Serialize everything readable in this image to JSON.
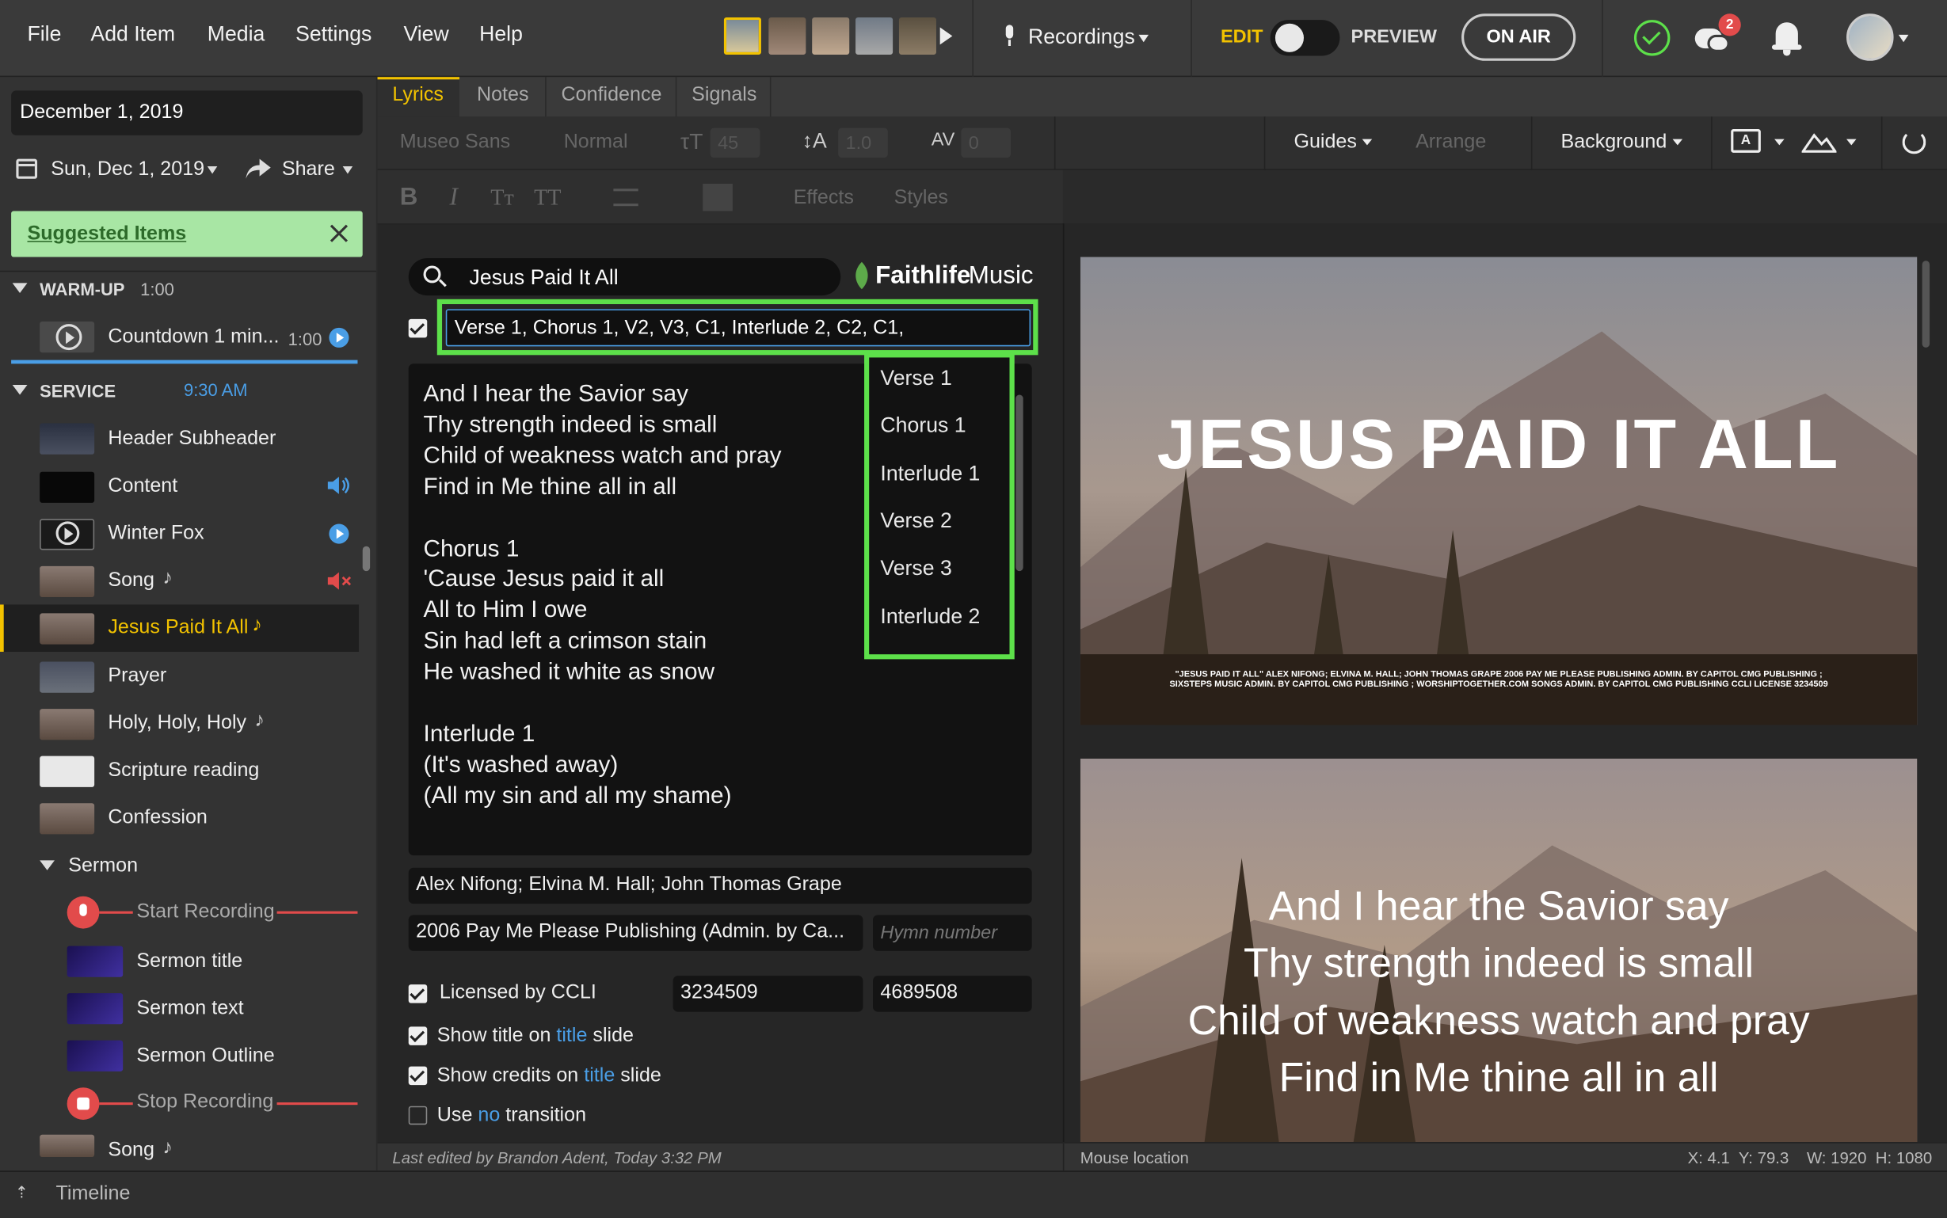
{
  "menu": {
    "file": "File",
    "add_item": "Add Item",
    "media": "Media",
    "settings": "Settings",
    "view": "View",
    "help": "Help"
  },
  "topbar": {
    "recordings": "Recordings",
    "edit": "EDIT",
    "preview": "PREVIEW",
    "on_air": "ON AIR",
    "notif_count": "2"
  },
  "sidebar": {
    "date_title": "December 1, 2019",
    "date_picker": "Sun, Dec 1, 2019",
    "share": "Share",
    "suggested": "Suggested Items",
    "warmup": {
      "label": "WARM-UP",
      "time": "1:00"
    },
    "countdown": {
      "label": "Countdown 1 min...",
      "time": "1:00"
    },
    "service": {
      "label": "SERVICE",
      "time": "9:30 AM"
    },
    "items": [
      "Header Subheader",
      "Content",
      "Winter Fox",
      "Song",
      "Jesus Paid It All",
      "Prayer",
      "Holy, Holy, Holy",
      "Scripture reading",
      "Confession"
    ],
    "sermon": "Sermon",
    "sermon_items": [
      "Start Recording",
      "Sermon title",
      "Sermon text",
      "Sermon Outline",
      "Stop Recording"
    ],
    "last_song": "Song",
    "timeline": "Timeline"
  },
  "tabs": [
    "Lyrics",
    "Notes",
    "Confidence",
    "Signals"
  ],
  "toolbar": {
    "font": "Museo Sans",
    "weight": "Normal",
    "size": "45",
    "line_height": "1.0",
    "tracking": "0",
    "guides": "Guides",
    "arrange": "Arrange",
    "background": "Background",
    "effects": "Effects",
    "styles": "Styles"
  },
  "editor": {
    "search": "Jesus Paid It All",
    "brand_a": "Faithlife",
    "brand_b": "Music",
    "order": "Verse 1, Chorus 1, V2, V3, C1, Interlude 2, C2, C1,",
    "lyrics": [
      "And I hear the Savior say",
      "Thy strength indeed is small",
      "Child of weakness watch and pray",
      "Find in Me thine all in all",
      "",
      "Chorus 1",
      "'Cause Jesus paid it all",
      "All to Him I owe",
      "Sin had left a crimson stain",
      "He washed it white as snow",
      "",
      "Interlude 1",
      "(It's washed away)",
      "(All my sin and all my shame)"
    ],
    "dropdown": [
      "Verse 1",
      "Chorus 1",
      "Interlude 1",
      "Verse 2",
      "Verse 3",
      "Interlude 2"
    ],
    "authors": "Alex Nifong; Elvina M. Hall; John Thomas Grape",
    "copyright": "2006 Pay Me Please Publishing (Admin. by Ca...",
    "hymn_placeholder": "Hymn number",
    "ccli_label": "Licensed by CCLI",
    "ccli_license": "3234509",
    "ccli_song": "4689508",
    "show_title_a": "Show title on",
    "show_title_b": "title",
    "show_title_c": "slide",
    "show_credits_a": "Show credits on",
    "show_credits_b": "title",
    "show_credits_c": "slide",
    "use_a": "Use",
    "use_b": "no",
    "use_c": "transition",
    "last_edited": "Last edited by Brandon Adent, Today 3:32 PM"
  },
  "preview": {
    "title": "JESUS PAID IT ALL",
    "credits1": "\"JESUS PAID IT ALL\" ALEX NIFONG; ELVINA M. HALL; JOHN THOMAS GRAPE 2006 PAY ME PLEASE PUBLISHING  ADMIN. BY CAPITOL CMG PUBLISHING ;",
    "credits2": "SIXSTEPS MUSIC  ADMIN. BY CAPITOL CMG PUBLISHING ; WORSHIPTOGETHER.COM SONGS  ADMIN. BY CAPITOL CMG PUBLISHING  CCLI LICENSE  3234509",
    "lines": [
      "And I hear the Savior say",
      "Thy strength indeed is small",
      "Child of weakness watch and pray",
      "Find in Me thine all in all"
    ],
    "mouse": "Mouse location",
    "coords": "X: 4.1  Y: 79.3    W: 1920  H: 1080"
  },
  "colors": {
    "accent_yellow": "#f2c200",
    "highlight_green": "#5de04a",
    "blue": "#4a9ee6",
    "red": "#e24b4b"
  }
}
